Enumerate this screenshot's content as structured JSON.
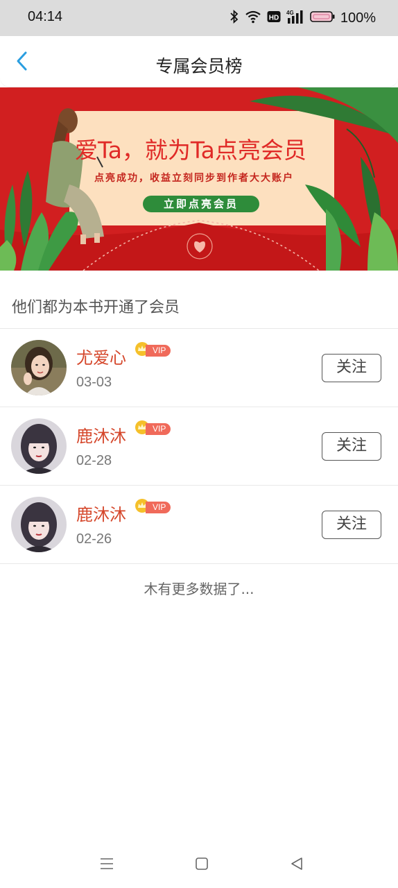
{
  "status_bar": {
    "time": "04:14",
    "battery_percent": "100%",
    "battery_level": 1.0,
    "network": "4G",
    "hd_label": "HD",
    "icons": [
      "bluetooth-icon",
      "wifi-icon",
      "hd-icon",
      "signal-icon",
      "battery-icon"
    ]
  },
  "header": {
    "title": "专属会员榜",
    "back_icon": "chevron-left-icon"
  },
  "banner": {
    "headline": "爱Ta，就为Ta点亮会员",
    "subtitle": "点亮成功，收益立刻同步到作者大大账户",
    "button_label": "立即点亮会员",
    "colors": {
      "background": "#d11f20",
      "card": "#fde0bf",
      "button": "#2e8c3a"
    }
  },
  "section": {
    "title": "他们都为本书开通了会员"
  },
  "members": [
    {
      "name": "尤爱心",
      "vip_label": "VIP",
      "date": "03-03",
      "follow_label": "关注",
      "avatar": "avatar-photo-1"
    },
    {
      "name": "鹿沐沐",
      "vip_label": "VIP",
      "date": "02-28",
      "follow_label": "关注",
      "avatar": "avatar-photo-2"
    },
    {
      "name": "鹿沐沐",
      "vip_label": "VIP",
      "date": "02-26",
      "follow_label": "关注",
      "avatar": "avatar-photo-2"
    }
  ],
  "footer": {
    "no_more_text": "木有更多数据了..."
  },
  "system_nav": {
    "icons": [
      "menu-icon",
      "home-square-icon",
      "back-triangle-icon"
    ]
  },
  "colors": {
    "name": "#d5472b",
    "vip_tag": "#f06a5a",
    "accent_back": "#2a9ee0"
  }
}
